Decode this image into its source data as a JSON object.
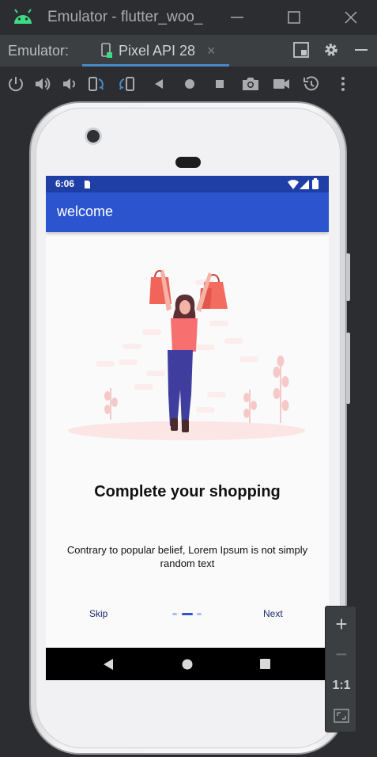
{
  "window": {
    "title": "Emulator - flutter_woo_",
    "icons": [
      "android-icon",
      "minimize-icon",
      "maximize-icon",
      "close-icon"
    ]
  },
  "tabs": {
    "label": "Emulator:",
    "active_tab": "Pixel API 28",
    "close_glyph": "×"
  },
  "toolbar": {
    "tools": [
      "power-icon",
      "volume-up-icon",
      "volume-down-icon",
      "rotate-left-icon",
      "rotate-right-icon",
      "back-icon",
      "home-icon",
      "overview-icon",
      "screenshot-icon",
      "screen-record-icon",
      "snapshot-icon",
      "more-icon"
    ]
  },
  "device": {
    "status_time": "6:06",
    "appbar_title": "welcome",
    "headline": "Complete your shopping",
    "body": "Contrary to popular belief, Lorem Ipsum is not simply random text",
    "skip_label": "Skip",
    "next_label": "Next",
    "page_indicator": {
      "count": 3,
      "active_index": 1
    },
    "colors": {
      "status_bar": "#1f3fa6",
      "app_bar": "#2c54cf",
      "indicator_active": "#2c54cf",
      "indicator_inactive": "#a9bdf0",
      "accent_illustration": "#ff6b6b",
      "pants": "#3f3d9e"
    }
  },
  "zoom": {
    "plus": "+",
    "minus": "−",
    "one_to_one": "1:1"
  }
}
